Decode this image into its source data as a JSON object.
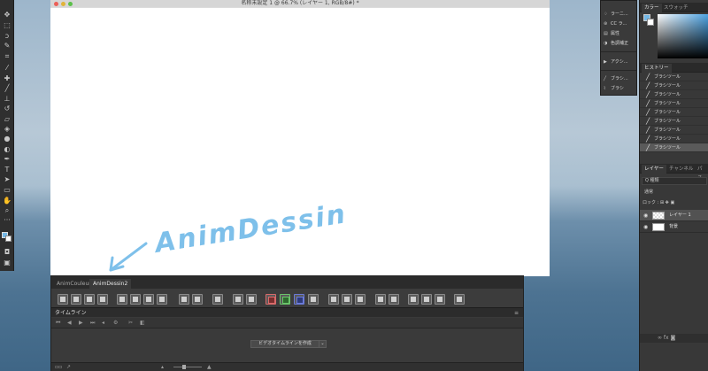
{
  "document": {
    "title": "名称未設定 1 @ 66.7% (レイヤー 1, RGB/8#) *",
    "canvas_text": "AnimDessin"
  },
  "toolbar": {
    "tools": [
      "move-icon",
      "marquee-icon",
      "lasso-icon",
      "quick-select-icon",
      "crop-icon",
      "eyedropper-icon",
      "healing-icon",
      "brush-icon",
      "stamp-icon",
      "history-brush-icon",
      "eraser-icon",
      "bucket-icon",
      "blur-icon",
      "dodge-icon",
      "pen-icon",
      "type-icon",
      "path-select-icon",
      "shape-icon",
      "hand-icon",
      "zoom-icon",
      "more-icon"
    ],
    "fg_color": "#74b8e6",
    "bg_color": "#ffffff"
  },
  "anim_panel": {
    "tabs": [
      "AnimCouleur2",
      "AnimDessin2"
    ],
    "active_tab": "AnimDessin2",
    "timeline_title": "タイムライン",
    "create_button": "ビデオタイムラインを作成",
    "footer_left": "⏮⏭"
  },
  "prop_menu": {
    "items": [
      {
        "icon": "lightbulb-icon",
        "label": "ラーニ..."
      },
      {
        "icon": "cc-icon",
        "label": "CC ラ..."
      },
      {
        "icon": "properties-icon",
        "label": "属性"
      },
      {
        "icon": "adjust-icon",
        "label": "色調補正"
      },
      {
        "icon": "play-icon",
        "label": "アクシ..."
      },
      {
        "icon": "brush-icon",
        "label": "ブラシ..."
      },
      {
        "icon": "brush-settings-icon",
        "label": "ブラシ"
      }
    ]
  },
  "right_panels": {
    "color_tabs": [
      "カラー",
      "スウォッチ"
    ],
    "history_tab": "ヒストリー",
    "history_items": [
      "ブラシツール",
      "ブラシツール",
      "ブラシツール",
      "ブラシツール",
      "ブラシツール",
      "ブラシツール",
      "ブラシツール",
      "ブラシツール",
      "ブラシツール"
    ],
    "layer_tabs": [
      "レイヤー",
      "チャンネル",
      "パス"
    ],
    "filter_label": "Q 種類",
    "blend_label": "通常",
    "lock_label": "ロック :",
    "layers": [
      {
        "name": "レイヤー 1",
        "selected": true
      },
      {
        "name": "背景",
        "selected": false
      }
    ],
    "layer_foot": "fx"
  }
}
